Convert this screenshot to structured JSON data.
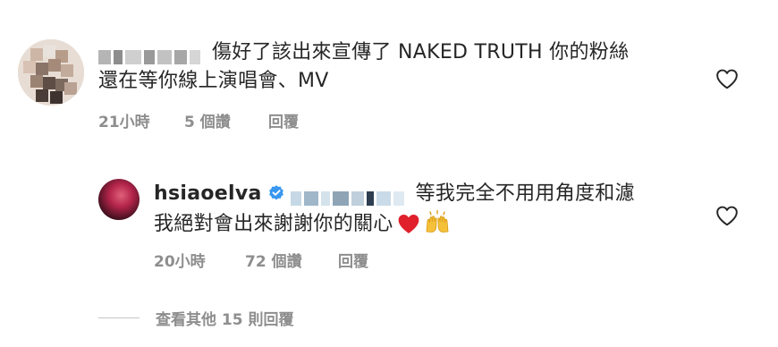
{
  "comment": {
    "text_line1": "傷好了該出來宣傳了 NAKED TRUTH 你的粉絲",
    "text_line2": "還在等你線上演唱會、MV",
    "time": "21小時",
    "likes": "5 個讚",
    "reply_label": "回覆",
    "like_icon": "heart-outline-icon"
  },
  "reply": {
    "username": "hsiaoelva",
    "verified_icon": "verified-badge-icon",
    "text_line1": "等我完全不用用角度和濾",
    "text_line2": "我絕對會出來謝謝你的關心",
    "emoji_heart": "❤️",
    "emoji_raised_hands": "🙌",
    "time": "20小時",
    "likes": "72 個讚",
    "reply_label": "回覆",
    "like_icon": "heart-outline-icon"
  },
  "view_more": {
    "label": "查看其他 15 則回覆"
  },
  "colors": {
    "text": "#262626",
    "secondary": "#8e8e8e",
    "verified_blue": "#3897f0",
    "heart_red": "#e0202b"
  }
}
